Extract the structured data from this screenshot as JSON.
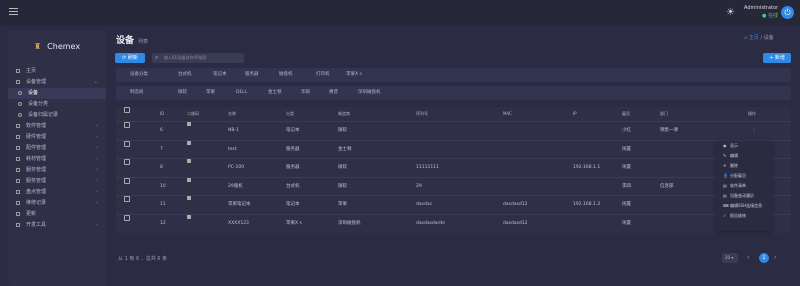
{
  "topbar": {
    "user": "Administrator",
    "status": "在线",
    "colors": {
      "accent": "#2e8ae6",
      "online": "#4ec96f"
    }
  },
  "sidebar": {
    "app": "Chemex",
    "items": [
      {
        "label": "主页",
        "sub": false
      },
      {
        "label": "设备管理",
        "sub": false
      },
      {
        "label": "设备",
        "sub": true
      },
      {
        "label": "设备分类",
        "sub": true
      },
      {
        "label": "设备归属记录",
        "sub": true
      },
      {
        "label": "软件管理",
        "sub": false
      },
      {
        "label": "硬件管理",
        "sub": false
      },
      {
        "label": "配件管理",
        "sub": false
      },
      {
        "label": "耗材管理",
        "sub": false
      },
      {
        "label": "服务管理",
        "sub": false
      },
      {
        "label": "服务管理",
        "sub": false
      },
      {
        "label": "盘点管理",
        "sub": false
      },
      {
        "label": "维修记录",
        "sub": false
      },
      {
        "label": "更新",
        "sub": false
      },
      {
        "label": "开发工具",
        "sub": false
      }
    ]
  },
  "page": {
    "title": "设备",
    "subtitle": "列表",
    "breadcrumb_home": "主页",
    "breadcrumb_current": "设备",
    "refresh": "刷新",
    "search_placeholder": "输入ID/设备名称/IP搜索",
    "new": "新增"
  },
  "filters": {
    "row1": [
      "设备分类",
      "台式机",
      "笔记本",
      "服务器",
      "磁盘机",
      "打印机",
      "苹果X s"
    ],
    "row2": [
      "制造商",
      "微软",
      "苹果",
      "DELL",
      "金士顿",
      "华硕",
      "惠普",
      "深圳磁盘机"
    ]
  },
  "table": {
    "headers": [
      "ID",
      "二维码",
      "名称",
      "分类",
      "制造商",
      "序列号",
      "MAC",
      "IP",
      "雇员",
      "部门",
      "操作"
    ],
    "rows": [
      [
        "6",
        "",
        "NB-1",
        "笔记本",
        "微软",
        "",
        "",
        "",
        "小红",
        "销售一课"
      ],
      [
        "7",
        "",
        "test",
        "服务器",
        "金士顿",
        "",
        "",
        "",
        "闲置",
        ""
      ],
      [
        "8",
        "",
        "PC-100",
        "服务器",
        "微软",
        "11111111",
        "",
        "192.168.1.1",
        "闲置",
        ""
      ],
      [
        "10",
        "",
        "29服机",
        "台式机",
        "微软",
        "29",
        "",
        "",
        "李四",
        "信息部"
      ],
      [
        "11",
        "",
        "苹果笔记本",
        "笔记本",
        "苹果",
        "dasdac",
        "dasdasd12",
        "192.168.1.2",
        "闲置",
        ""
      ],
      [
        "12",
        "",
        "XXXX123",
        "苹果X s",
        "深圳磁盘机",
        "dasdasdarde",
        "dasdasd12",
        "",
        "闲置",
        ""
      ]
    ]
  },
  "menu": [
    "显示",
    "编辑",
    "删除",
    "分配雇员",
    "软件清单",
    "设备变动履历",
    "编辑SSH连接信息",
    "报告维修"
  ],
  "footer": {
    "summary": "从 1 到 6 ，总共 6 条",
    "page_size": "20",
    "page": "1"
  }
}
